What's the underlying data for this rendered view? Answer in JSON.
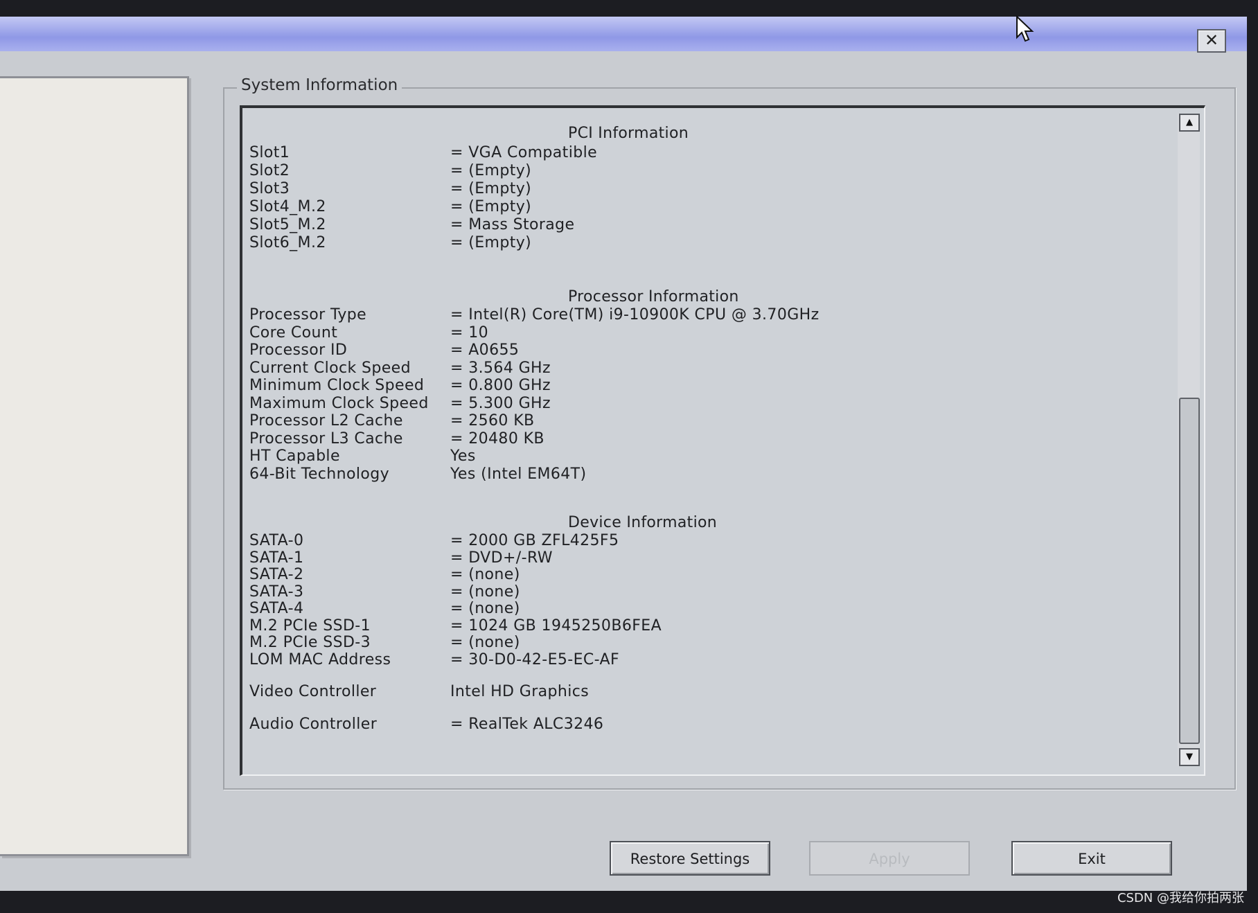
{
  "window": {
    "close_glyph": "✕"
  },
  "group_title": "System Information",
  "sections": {
    "pci": {
      "heading": "PCI Information",
      "rows": [
        {
          "label": "Slot1",
          "value": "= VGA Compatible"
        },
        {
          "label": "Slot2",
          "value": "= (Empty)"
        },
        {
          "label": "Slot3",
          "value": "= (Empty)"
        },
        {
          "label": "Slot4_M.2",
          "value": "= (Empty)"
        },
        {
          "label": "Slot5_M.2",
          "value": "= Mass Storage"
        },
        {
          "label": "Slot6_M.2",
          "value": "= (Empty)"
        }
      ]
    },
    "processor": {
      "heading": "Processor Information",
      "rows": [
        {
          "label": "Processor Type",
          "value": "= Intel(R) Core(TM) i9-10900K CPU @ 3.70GHz"
        },
        {
          "label": "Core Count",
          "value": "= 10"
        },
        {
          "label": "Processor ID",
          "value": "= A0655"
        },
        {
          "label": "Current Clock Speed",
          "value": "= 3.564 GHz"
        },
        {
          "label": "Minimum Clock Speed",
          "value": "= 0.800 GHz"
        },
        {
          "label": "Maximum Clock Speed",
          "value": "= 5.300 GHz"
        },
        {
          "label": "Processor L2 Cache",
          "value": "= 2560 KB"
        },
        {
          "label": "Processor L3 Cache",
          "value": "= 20480 KB"
        },
        {
          "label": "HT Capable",
          "value": "Yes"
        },
        {
          "label": "64-Bit Technology",
          "value": "Yes (Intel EM64T)"
        }
      ]
    },
    "device": {
      "heading": "Device Information",
      "rows": [
        {
          "label": "SATA-0",
          "value": "= 2000 GB ZFL425F5"
        },
        {
          "label": "SATA-1",
          "value": "= DVD+/-RW"
        },
        {
          "label": "SATA-2",
          "value": "= (none)"
        },
        {
          "label": "SATA-3",
          "value": "= (none)"
        },
        {
          "label": "SATA-4",
          "value": "= (none)"
        },
        {
          "label": "M.2 PCIe SSD-1",
          "value": "= 1024 GB 1945250B6FEA"
        },
        {
          "label": "M.2 PCIe SSD-3",
          "value": "= (none)"
        },
        {
          "label": "LOM MAC Address",
          "value": "= 30-D0-42-E5-EC-AF"
        },
        {
          "label": "Video Controller",
          "value": "Intel HD Graphics"
        },
        {
          "label": "Audio Controller",
          "value": "= RealTek ALC3246"
        }
      ]
    }
  },
  "scrollbar": {
    "up_glyph": "▲",
    "down_glyph": "▼"
  },
  "buttons": {
    "restore": "Restore Settings",
    "apply": "Apply",
    "exit": "Exit"
  },
  "watermark": "CSDN @我给你拍两张"
}
